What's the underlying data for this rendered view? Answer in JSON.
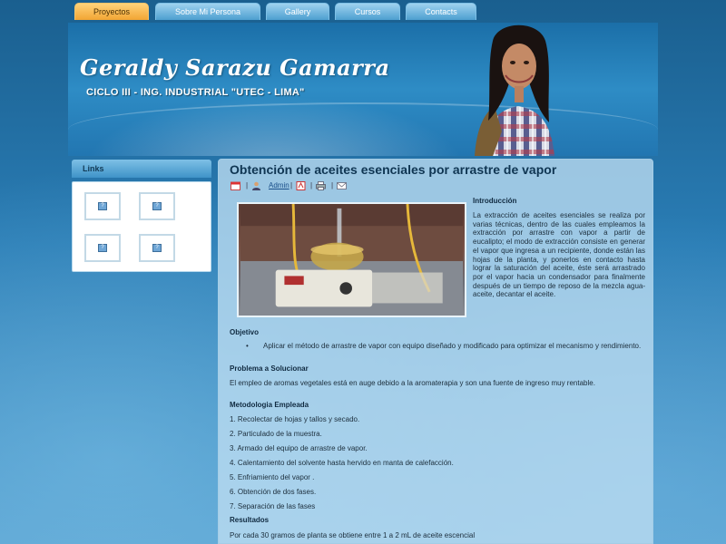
{
  "nav": {
    "tabs": [
      {
        "label": "Proyectos",
        "active": true
      },
      {
        "label": "Sobre Mi Persona",
        "active": false
      },
      {
        "label": "Gallery",
        "active": false
      },
      {
        "label": "Cursos",
        "active": false
      },
      {
        "label": "Contacts",
        "active": false
      }
    ]
  },
  "header": {
    "title": "Geraldy Sarazu Gamarra",
    "subtitle": "CICLO III - ING. INDUSTRIAL \"UTEC - LIMA\""
  },
  "sidebar": {
    "heading": "Links",
    "items": [
      {
        "icon": "broken-image-icon"
      },
      {
        "icon": "broken-image-icon"
      },
      {
        "icon": "broken-image-icon"
      },
      {
        "icon": "broken-image-icon"
      }
    ]
  },
  "article": {
    "title": "Obtención de aceites esenciales por arrastre de vapor",
    "meta": {
      "author": "Admin",
      "icons": [
        "calendar-icon",
        "user-icon",
        "pdf-icon",
        "print-icon",
        "email-icon"
      ]
    },
    "intro_heading": "Introducción",
    "intro_text": "La extracción de aceites esenciales se realiza por varias técnicas, dentro de las cuales empleamos la extracción por arrastre con vapor a partir de eucalipto; el modo de extracción consiste en generar el vapor que ingresa a un recipiente, donde están las hojas de la planta, y ponerlos en contacto hasta lograr la saturación del aceite, éste será arrastrado por el vapor hacia un condensador para finalmente después de un tiempo de reposo de la mezcla agua-aceite, decantar el aceite.",
    "objective_heading": "Objetivo",
    "objective_bullet": "•",
    "objective_text": "Aplicar el método de arrastre de vapor con equipo diseñado y modificado para optimizar el mecanismo y rendimiento.",
    "problem_heading": "Problema a Solucionar",
    "problem_text": "El empleo de aromas vegetales está en auge debido a la aromaterapia  y son una fuente de ingreso muy rentable.",
    "method_heading": "Metodologia Empleada",
    "method_steps": [
      "1. Recolectar  de hojas y tallos y secado.",
      "2. Particulado de la muestra.",
      "3. Armado del equipo de arrastre de vapor.",
      "4. Calentamiento del solvente hasta hervido en manta de calefacción.",
      "5. Enfriamiento del vapor .",
      "6. Obtención de dos fases.",
      "7. Separación de las fases"
    ],
    "results_heading": "Resultados",
    "results_text": "Por cada 30 gramos de planta se obtiene entre 1 a 2 mL de aceite escencial"
  }
}
